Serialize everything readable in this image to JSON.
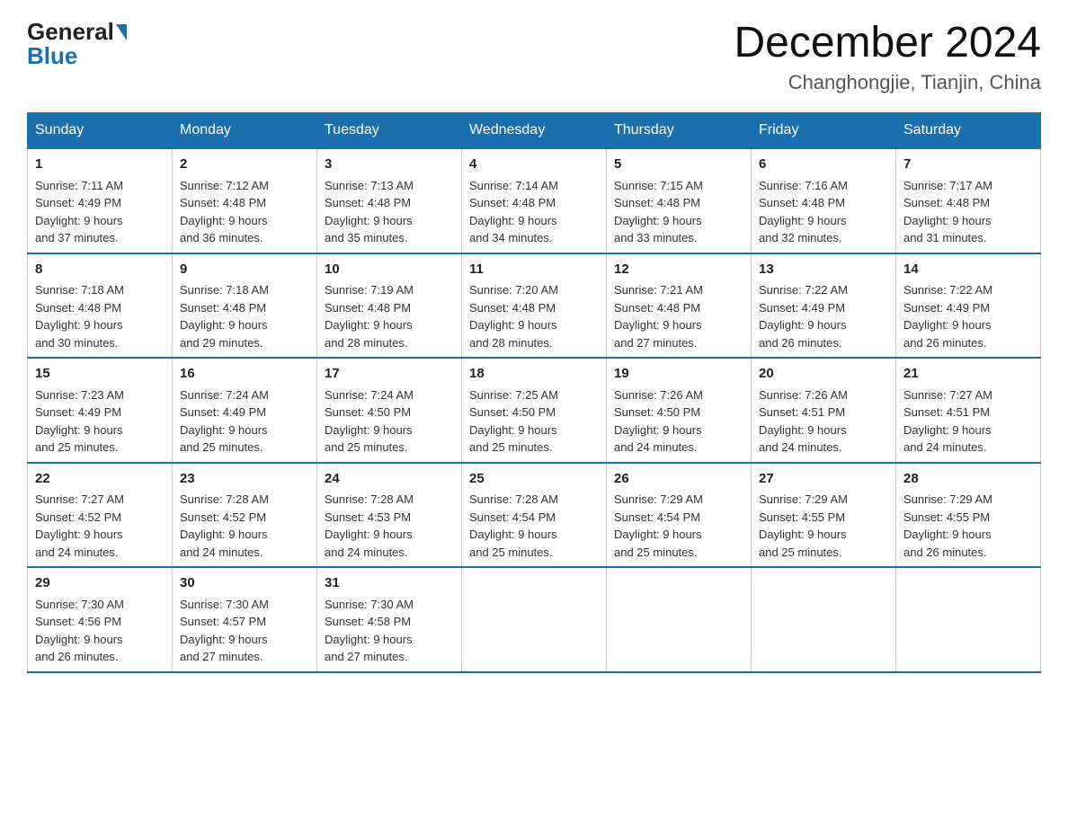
{
  "logo": {
    "general": "General",
    "blue": "Blue"
  },
  "title": {
    "month_year": "December 2024",
    "location": "Changhongjie, Tianjin, China"
  },
  "weekdays": [
    "Sunday",
    "Monday",
    "Tuesday",
    "Wednesday",
    "Thursday",
    "Friday",
    "Saturday"
  ],
  "weeks": [
    [
      {
        "day": "1",
        "sunrise": "7:11 AM",
        "sunset": "4:49 PM",
        "daylight": "9 hours and 37 minutes."
      },
      {
        "day": "2",
        "sunrise": "7:12 AM",
        "sunset": "4:48 PM",
        "daylight": "9 hours and 36 minutes."
      },
      {
        "day": "3",
        "sunrise": "7:13 AM",
        "sunset": "4:48 PM",
        "daylight": "9 hours and 35 minutes."
      },
      {
        "day": "4",
        "sunrise": "7:14 AM",
        "sunset": "4:48 PM",
        "daylight": "9 hours and 34 minutes."
      },
      {
        "day": "5",
        "sunrise": "7:15 AM",
        "sunset": "4:48 PM",
        "daylight": "9 hours and 33 minutes."
      },
      {
        "day": "6",
        "sunrise": "7:16 AM",
        "sunset": "4:48 PM",
        "daylight": "9 hours and 32 minutes."
      },
      {
        "day": "7",
        "sunrise": "7:17 AM",
        "sunset": "4:48 PM",
        "daylight": "9 hours and 31 minutes."
      }
    ],
    [
      {
        "day": "8",
        "sunrise": "7:18 AM",
        "sunset": "4:48 PM",
        "daylight": "9 hours and 30 minutes."
      },
      {
        "day": "9",
        "sunrise": "7:18 AM",
        "sunset": "4:48 PM",
        "daylight": "9 hours and 29 minutes."
      },
      {
        "day": "10",
        "sunrise": "7:19 AM",
        "sunset": "4:48 PM",
        "daylight": "9 hours and 28 minutes."
      },
      {
        "day": "11",
        "sunrise": "7:20 AM",
        "sunset": "4:48 PM",
        "daylight": "9 hours and 28 minutes."
      },
      {
        "day": "12",
        "sunrise": "7:21 AM",
        "sunset": "4:48 PM",
        "daylight": "9 hours and 27 minutes."
      },
      {
        "day": "13",
        "sunrise": "7:22 AM",
        "sunset": "4:49 PM",
        "daylight": "9 hours and 26 minutes."
      },
      {
        "day": "14",
        "sunrise": "7:22 AM",
        "sunset": "4:49 PM",
        "daylight": "9 hours and 26 minutes."
      }
    ],
    [
      {
        "day": "15",
        "sunrise": "7:23 AM",
        "sunset": "4:49 PM",
        "daylight": "9 hours and 25 minutes."
      },
      {
        "day": "16",
        "sunrise": "7:24 AM",
        "sunset": "4:49 PM",
        "daylight": "9 hours and 25 minutes."
      },
      {
        "day": "17",
        "sunrise": "7:24 AM",
        "sunset": "4:50 PM",
        "daylight": "9 hours and 25 minutes."
      },
      {
        "day": "18",
        "sunrise": "7:25 AM",
        "sunset": "4:50 PM",
        "daylight": "9 hours and 25 minutes."
      },
      {
        "day": "19",
        "sunrise": "7:26 AM",
        "sunset": "4:50 PM",
        "daylight": "9 hours and 24 minutes."
      },
      {
        "day": "20",
        "sunrise": "7:26 AM",
        "sunset": "4:51 PM",
        "daylight": "9 hours and 24 minutes."
      },
      {
        "day": "21",
        "sunrise": "7:27 AM",
        "sunset": "4:51 PM",
        "daylight": "9 hours and 24 minutes."
      }
    ],
    [
      {
        "day": "22",
        "sunrise": "7:27 AM",
        "sunset": "4:52 PM",
        "daylight": "9 hours and 24 minutes."
      },
      {
        "day": "23",
        "sunrise": "7:28 AM",
        "sunset": "4:52 PM",
        "daylight": "9 hours and 24 minutes."
      },
      {
        "day": "24",
        "sunrise": "7:28 AM",
        "sunset": "4:53 PM",
        "daylight": "9 hours and 24 minutes."
      },
      {
        "day": "25",
        "sunrise": "7:28 AM",
        "sunset": "4:54 PM",
        "daylight": "9 hours and 25 minutes."
      },
      {
        "day": "26",
        "sunrise": "7:29 AM",
        "sunset": "4:54 PM",
        "daylight": "9 hours and 25 minutes."
      },
      {
        "day": "27",
        "sunrise": "7:29 AM",
        "sunset": "4:55 PM",
        "daylight": "9 hours and 25 minutes."
      },
      {
        "day": "28",
        "sunrise": "7:29 AM",
        "sunset": "4:55 PM",
        "daylight": "9 hours and 26 minutes."
      }
    ],
    [
      {
        "day": "29",
        "sunrise": "7:30 AM",
        "sunset": "4:56 PM",
        "daylight": "9 hours and 26 minutes."
      },
      {
        "day": "30",
        "sunrise": "7:30 AM",
        "sunset": "4:57 PM",
        "daylight": "9 hours and 27 minutes."
      },
      {
        "day": "31",
        "sunrise": "7:30 AM",
        "sunset": "4:58 PM",
        "daylight": "9 hours and 27 minutes."
      },
      null,
      null,
      null,
      null
    ]
  ],
  "labels": {
    "sunrise": "Sunrise:",
    "sunset": "Sunset:",
    "daylight": "Daylight:"
  }
}
